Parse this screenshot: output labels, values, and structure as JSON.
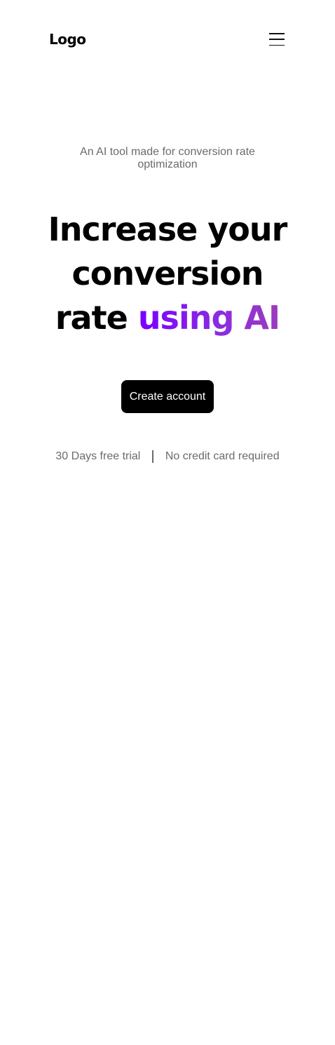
{
  "header": {
    "logo_text": "Logo",
    "menu_icon": "hamburger-menu-icon"
  },
  "hero": {
    "tagline": "An AI tool made for conversion rate optimization",
    "headline_plain": "Increase your conversion rate",
    "headline_accent": "using AI",
    "cta_label": "Create account",
    "perks": [
      "30 Days free trial",
      "No credit card required"
    ]
  },
  "colors": {
    "accent_start": "#7a00ff",
    "accent_end": "#9b3bbd",
    "cta_background": "#000000",
    "muted_text": "#6b6b6b"
  }
}
